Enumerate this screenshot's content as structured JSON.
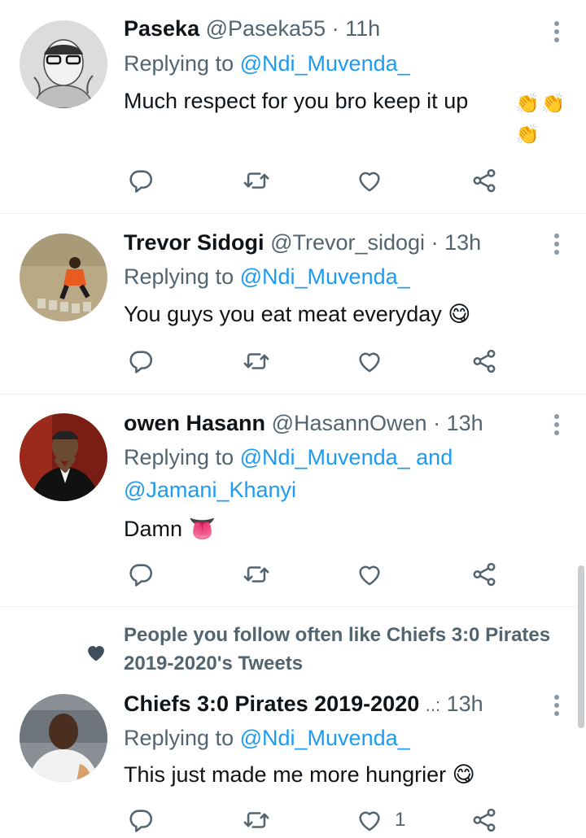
{
  "tweets": [
    {
      "name": "Paseka",
      "handle": "@Paseka55",
      "time": "11h",
      "replying": "Replying to",
      "mention1": "@Ndi_Muvenda_",
      "text": "Much respect for you bro keep it up",
      "emoji_line": "👏👏👏",
      "like_count": ""
    },
    {
      "name": "Trevor Sidogi",
      "handle": "@Trevor_sidogi",
      "time": "13h",
      "replying": "Replying to",
      "mention1": "@Ndi_Muvenda_",
      "text": "You guys you eat meat everyday",
      "emoji": "😋",
      "like_count": ""
    },
    {
      "name": "owen Hasann",
      "handle": "@HasannOwen",
      "time": "13h",
      "replying": "Replying to",
      "mention1": "@Ndi_Muvenda_",
      "and": "and",
      "mention2": "@Jamani_Khanyi",
      "text": "Damn",
      "emoji": "👅",
      "like_count": ""
    },
    {
      "social_context": "People you follow often like Chiefs 3:0 Pirates 2019-2020's Tweets",
      "name": "Chiefs 3:0 Pirates 2019-2020",
      "ellipsis": "..:",
      "time": "13h",
      "replying": "Replying to",
      "mention1": "@Ndi_Muvenda_",
      "text": "This just made me more hungrier",
      "emoji": "😋",
      "like_count": "1"
    }
  ],
  "separator": "·",
  "icons": {
    "reply": "reply-icon",
    "retweet": "retweet-icon",
    "like": "heart-icon",
    "share": "share-icon",
    "more": "more-vertical-icon"
  },
  "colors": {
    "text": "#0f1419",
    "secondary": "#536471",
    "link": "#1d9bf0",
    "divider": "#eff3f4"
  }
}
